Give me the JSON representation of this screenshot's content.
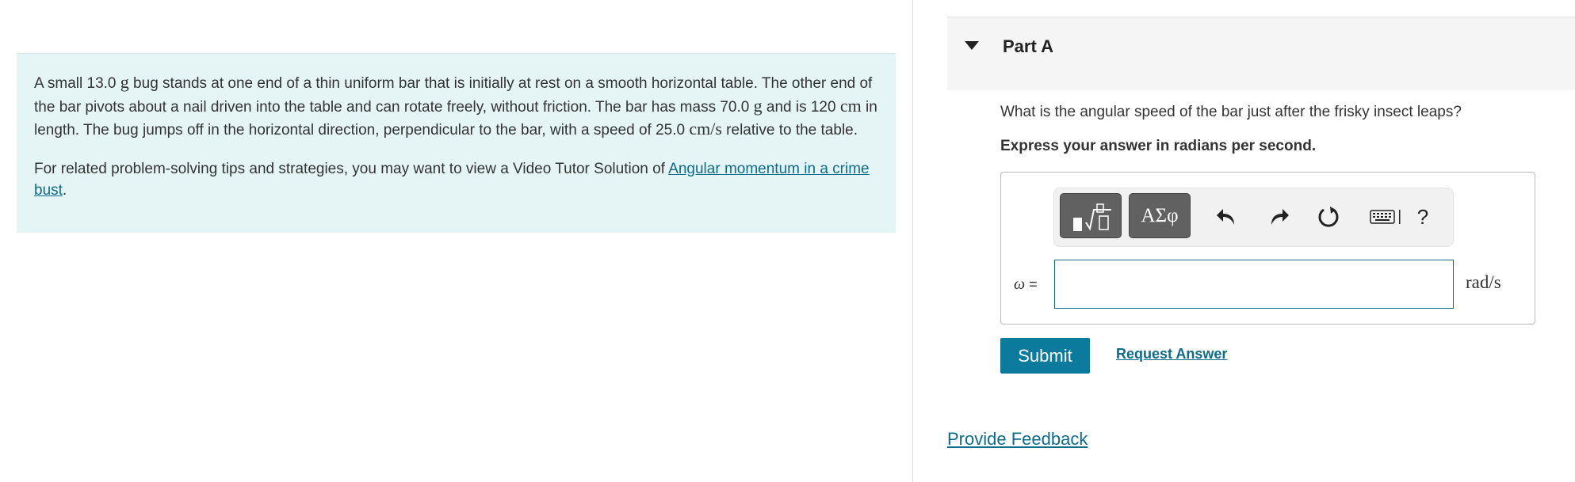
{
  "problem": {
    "p1_a": "A small 13.0 ",
    "p1_g1": "g",
    "p1_b": " bug stands at one end of a thin uniform bar that is initially at rest on a smooth horizontal table. The other end of the bar pivots about a nail driven into the table and can rotate freely, without friction. The bar has mass 70.0 ",
    "p1_g2": "g",
    "p1_c": " and is 120 ",
    "p1_cm": "cm",
    "p1_d": " in length. The bug jumps off in the horizontal direction, perpendicular to the bar, with a speed of 25.0 ",
    "p1_cms": "cm/s",
    "p1_e": " relative to the table.",
    "p2_text": "For related problem-solving tips and strategies, you may want to view a Video Tutor Solution of ",
    "p2_link": "Angular momentum in a crime bust",
    "p2_end": "."
  },
  "part": {
    "title": "Part A",
    "question": "What is the angular speed of the bar just after the frisky insect leaps?",
    "instruction": "Express your answer in radians per second."
  },
  "toolbar": {
    "greek_label": "ΑΣφ",
    "help_label": "?",
    "icons": [
      "templates-icon",
      "undo-icon",
      "redo-icon",
      "reset-icon",
      "keyboard-icon",
      "help-icon"
    ]
  },
  "answer": {
    "variable": "ω",
    "equals": " =",
    "value": "",
    "units": "rad/s"
  },
  "actions": {
    "submit_label": "Submit",
    "request_label": "Request Answer",
    "feedback_label": "Provide Feedback"
  },
  "colors": {
    "problem_bg": "#e5f5f5",
    "accent": "#0b7a9c",
    "link": "#0e6b8c"
  }
}
